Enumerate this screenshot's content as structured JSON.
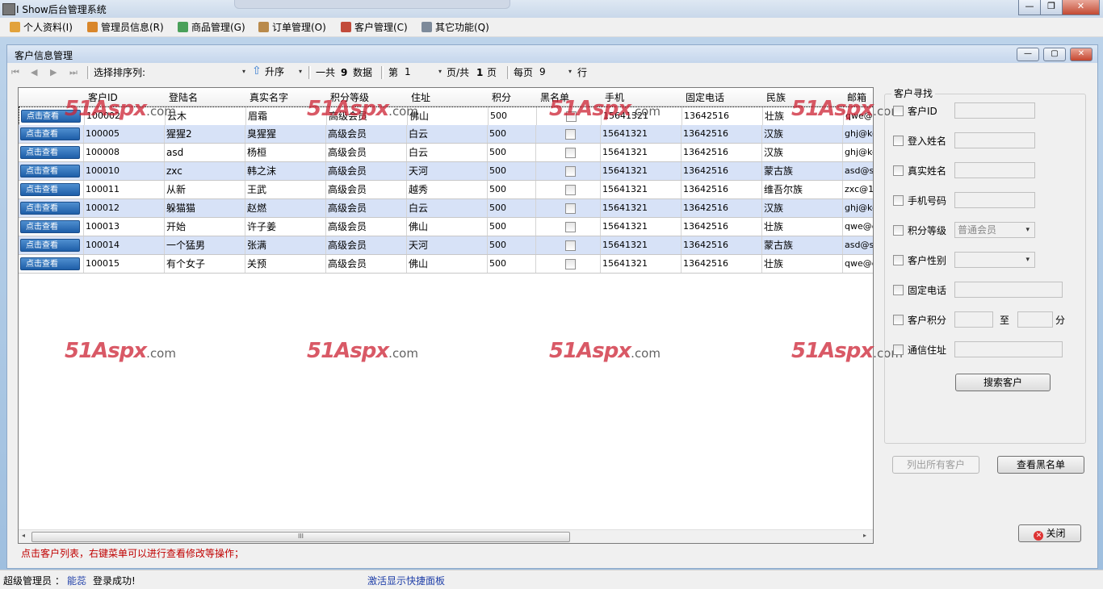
{
  "window": {
    "title": "I Show后台管理系统",
    "min": "—",
    "max": "❐",
    "close": "✕"
  },
  "menu": [
    {
      "label": "个人资料(I)",
      "color": "#e2a23b"
    },
    {
      "label": "管理员信息(R)",
      "color": "#d9862a"
    },
    {
      "label": "商品管理(G)",
      "color": "#4aa05a"
    },
    {
      "label": "订单管理(O)",
      "color": "#b98a4b"
    },
    {
      "label": "客户管理(C)",
      "color": "#c24b3b"
    },
    {
      "label": "其它功能(Q)",
      "color": "#7d8a9a"
    }
  ],
  "form": {
    "title": "客户信息管理",
    "min": "—",
    "max": "▢",
    "close": "✕"
  },
  "toolbar": {
    "nav_first": "⏮",
    "nav_prev": "◀",
    "nav_next": "▶",
    "nav_last": "⏭",
    "sort_label": "选择排序列:",
    "sort_value": "",
    "order_icon": "⇧",
    "order_value": "升序",
    "total_prefix": "一共",
    "total_count": "9",
    "total_suffix": "数据",
    "page_prefix": "第",
    "page_value": "1",
    "page_mid": "页/共",
    "page_total": "1",
    "page_suffix": "页",
    "per_prefix": "每页",
    "per_value": "9",
    "per_suffix": "行",
    "caret": "▾"
  },
  "grid": {
    "columns": [
      "客户ID",
      "登陆名",
      "真实名字",
      "积分等级",
      "住址",
      "积分",
      "黑名单",
      "手机",
      "固定电话",
      "民族",
      "邮箱"
    ],
    "view_button": "点击查看",
    "rows": [
      {
        "id": "100002",
        "login": "云木",
        "name": "眉霜",
        "level": "高级会员",
        "addr": "佛山",
        "score": "500",
        "phone": "15641321",
        "tel": "13642516",
        "nation": "壮族",
        "email": "qwe@qq"
      },
      {
        "id": "100005",
        "login": "猩猩2",
        "name": "臭猩猩",
        "level": "高级会员",
        "addr": "白云",
        "score": "500",
        "phone": "15641321",
        "tel": "13642516",
        "nation": "汉族",
        "email": "ghj@ke"
      },
      {
        "id": "100008",
        "login": "asd",
        "name": "杨桓",
        "level": "高级会员",
        "addr": "白云",
        "score": "500",
        "phone": "15641321",
        "tel": "13642516",
        "nation": "汉族",
        "email": "ghj@ke"
      },
      {
        "id": "100010",
        "login": "zxc",
        "name": "韩之沫",
        "level": "高级会员",
        "addr": "天河",
        "score": "500",
        "phone": "15641321",
        "tel": "13642516",
        "nation": "蒙古族",
        "email": "asd@si"
      },
      {
        "id": "100011",
        "login": "从新",
        "name": "王武",
        "level": "高级会员",
        "addr": "越秀",
        "score": "500",
        "phone": "15641321",
        "tel": "13642516",
        "nation": "维吾尔族",
        "email": "zxc@16"
      },
      {
        "id": "100012",
        "login": "躲猫猫",
        "name": "赵燃",
        "level": "高级会员",
        "addr": "白云",
        "score": "500",
        "phone": "15641321",
        "tel": "13642516",
        "nation": "汉族",
        "email": "ghj@ke"
      },
      {
        "id": "100013",
        "login": "开始",
        "name": "许子姜",
        "level": "高级会员",
        "addr": "佛山",
        "score": "500",
        "phone": "15641321",
        "tel": "13642516",
        "nation": "壮族",
        "email": "qwe@qq"
      },
      {
        "id": "100014",
        "login": "一个猛男",
        "name": "张满",
        "level": "高级会员",
        "addr": "天河",
        "score": "500",
        "phone": "15641321",
        "tel": "13642516",
        "nation": "蒙古族",
        "email": "asd@si"
      },
      {
        "id": "100015",
        "login": "有个女子",
        "name": "关预",
        "level": "高级会员",
        "addr": "佛山",
        "score": "500",
        "phone": "15641321",
        "tel": "13642516",
        "nation": "壮族",
        "email": "qwe@qq"
      }
    ],
    "scroll_left": "◂",
    "scroll_right": "▸",
    "scroll_grip": "III"
  },
  "hint": "点击客户列表，右键菜单可以进行查看修改等操作；",
  "watermark": {
    "brand": "51Aspx",
    "suffix": ".com"
  },
  "search": {
    "title": "客户寻找",
    "fields": [
      {
        "label": "客户ID",
        "value": ""
      },
      {
        "label": "登入姓名",
        "value": ""
      },
      {
        "label": "真实姓名",
        "value": ""
      },
      {
        "label": "手机号码",
        "value": ""
      },
      {
        "label": "积分等级",
        "value": "普通会员"
      },
      {
        "label": "客户性别",
        "value": ""
      },
      {
        "label": "固定电话",
        "value": ""
      },
      {
        "label": "客户积分",
        "value": ""
      },
      {
        "label": "通信住址",
        "value": ""
      }
    ],
    "score_to": "至",
    "score_unit": "分",
    "search_button": "搜索客户"
  },
  "buttons": {
    "list_all": "列出所有客户",
    "blacklist": "查看黑名单",
    "close": "关闭",
    "close_icon": "✕"
  },
  "status": {
    "role": "超级管理员 ：",
    "user": "能蕊",
    "message": "登录成功!",
    "shortcut": "激活显示快捷面板"
  }
}
